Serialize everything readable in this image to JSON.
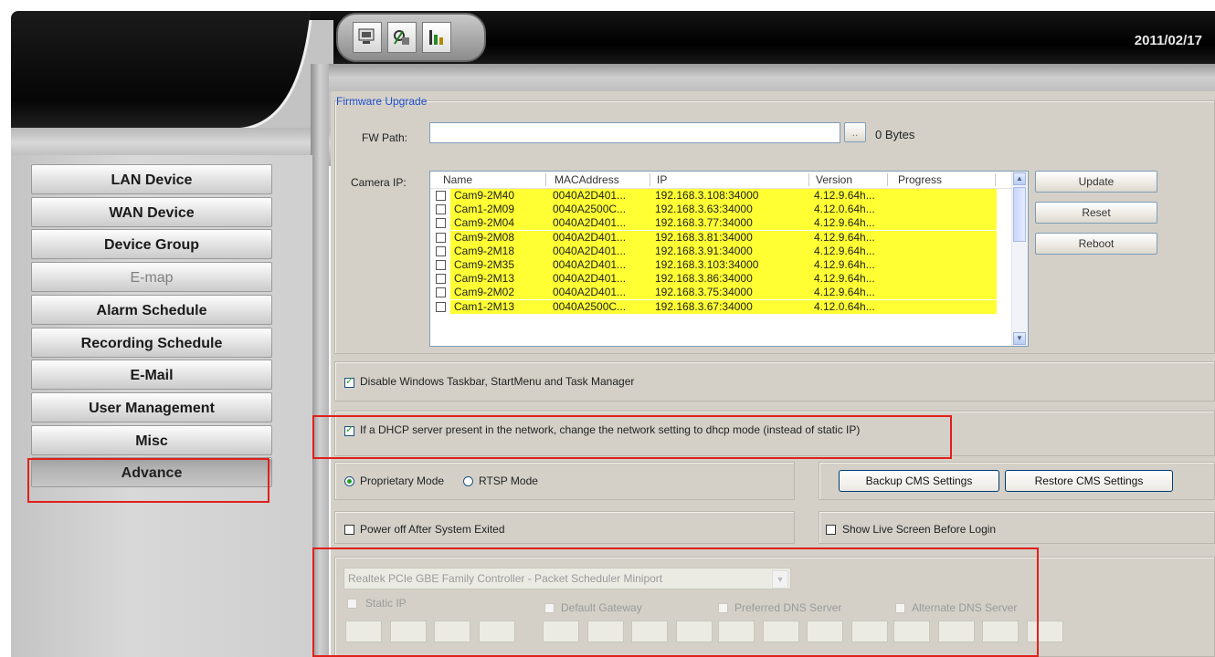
{
  "header": {
    "date": "2011/02/17",
    "toolbar_icons": [
      "monitor-icon",
      "network-settings-icon",
      "tools-icon"
    ]
  },
  "sidebar": {
    "items": [
      {
        "label": "LAN Device",
        "state": "normal"
      },
      {
        "label": "WAN Device",
        "state": "normal"
      },
      {
        "label": "Device Group",
        "state": "normal"
      },
      {
        "label": "E-map",
        "state": "disabled"
      },
      {
        "label": "Alarm Schedule",
        "state": "normal"
      },
      {
        "label": "Recording Schedule",
        "state": "normal"
      },
      {
        "label": "E-Mail",
        "state": "normal"
      },
      {
        "label": "User Management",
        "state": "normal"
      },
      {
        "label": "Misc",
        "state": "normal"
      },
      {
        "label": "Advance",
        "state": "active"
      }
    ]
  },
  "firmware": {
    "group_title": "Firmware Upgrade",
    "fw_path_label": "FW Path:",
    "fw_path_value": "",
    "browse_label": "..",
    "size_text": "0 Bytes",
    "camera_ip_label": "Camera IP:",
    "columns": [
      "Name",
      "MACAddress",
      "IP",
      "Version",
      "Progress"
    ],
    "cameras": [
      {
        "name": "Cam9-2M40",
        "mac": "0040A2D401...",
        "ip": "192.168.3.108:34000",
        "version": "4.12.9.64h...",
        "progress": ""
      },
      {
        "name": "Cam1-2M09",
        "mac": "0040A2500C...",
        "ip": "192.168.3.63:34000",
        "version": "4.12.0.64h...",
        "progress": ""
      },
      {
        "name": "Cam9-2M04",
        "mac": "0040A2D401...",
        "ip": "192.168.3.77:34000",
        "version": "4.12.9.64h...",
        "progress": ""
      },
      {
        "name": "Cam9-2M08",
        "mac": "0040A2D401...",
        "ip": "192.168.3.81:34000",
        "version": "4.12.9.64h...",
        "progress": ""
      },
      {
        "name": "Cam9-2M18",
        "mac": "0040A2D401...",
        "ip": "192.168.3.91:34000",
        "version": "4.12.9.64h...",
        "progress": ""
      },
      {
        "name": "Cam9-2M35",
        "mac": "0040A2D401...",
        "ip": "192.168.3.103:34000",
        "version": "4.12.9.64h...",
        "progress": ""
      },
      {
        "name": "Cam9-2M13",
        "mac": "0040A2D401...",
        "ip": "192.168.3.86:34000",
        "version": "4.12.9.64h...",
        "progress": ""
      },
      {
        "name": "Cam9-2M02",
        "mac": "0040A2D401...",
        "ip": "192.168.3.75:34000",
        "version": "4.12.9.64h...",
        "progress": ""
      },
      {
        "name": "Cam1-2M13",
        "mac": "0040A2500C...",
        "ip": "192.168.3.67:34000",
        "version": "4.12.0.64h...",
        "progress": ""
      }
    ],
    "update_label": "Update",
    "reset_label": "Reset",
    "reboot_label": "Reboot",
    "scroll_up": "▲",
    "scroll_down": "▼"
  },
  "options": {
    "disable_taskbar_label": "Disable Windows Taskbar, StartMenu and Task Manager",
    "disable_taskbar_checked": true,
    "dhcp_label": "If a DHCP server present in the network, change the network setting to dhcp mode (instead of static IP)",
    "dhcp_checked": true,
    "proprietary_label": "Proprietary Mode",
    "rtsp_label": "RTSP Mode",
    "selected_mode": "Proprietary Mode",
    "backup_label": "Backup CMS Settings",
    "restore_label": "Restore CMS Settings",
    "power_off_label": "Power off After System Exited",
    "power_off_checked": false,
    "show_live_label": "Show Live Screen Before Login",
    "show_live_checked": false
  },
  "network": {
    "adapter": "Realtek PCIe GBE Family Controller - Packet Scheduler Miniport",
    "static_ip_label": "Static IP",
    "gateway_label": "Default Gateway",
    "preferred_dns_label": "Preferred DNS Server",
    "alternate_dns_label": "Alternate DNS Server"
  },
  "colors": {
    "row_highlight": "#ffff33",
    "group_title": "#1f4fcf",
    "annotation_box": "#e1201b"
  }
}
